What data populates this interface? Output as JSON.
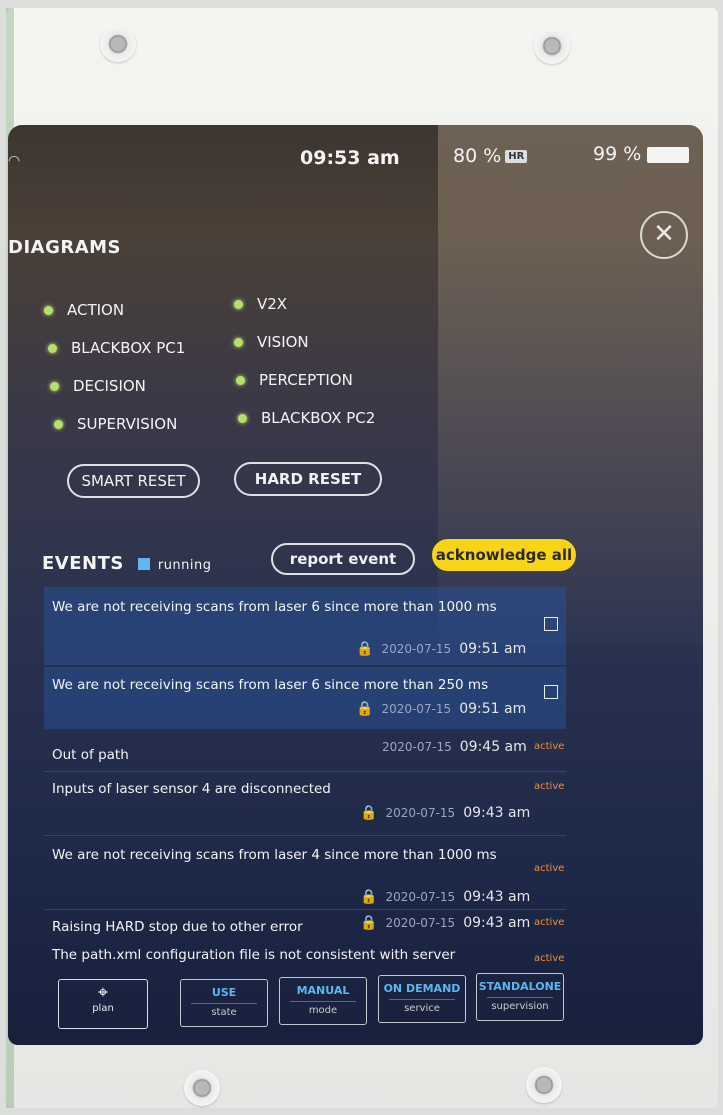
{
  "status_bar": {
    "time": "09:53 am",
    "hr_level": "80 %",
    "hr_badge": "HR",
    "battery_level": "99 %"
  },
  "diagrams": {
    "title": "DIAGRAMS",
    "left_items": [
      "ACTION",
      "BLACKBOX PC1",
      "DECISION",
      "SUPERVISION"
    ],
    "right_items": [
      "V2X",
      "VISION",
      "PERCEPTION",
      "BLACKBOX PC2"
    ],
    "indicator_color": "#b6e06a",
    "smart_reset_label": "SMART RESET",
    "hard_reset_label": "HARD RESET"
  },
  "events": {
    "title": "EVENTS",
    "running_label": "running",
    "report_event_label": "report event",
    "acknowledge_all_label": "acknowledge all",
    "accent_color": "#f7d516",
    "items": [
      {
        "message": "We are not receiving scans from laser 6 since more than 1000 ms",
        "date": "2020-07-15",
        "time": "09:51 am",
        "status": ""
      },
      {
        "message": "We are not receiving scans from laser 6 since more than 250 ms",
        "date": "2020-07-15",
        "time": "09:51 am",
        "status": ""
      },
      {
        "message": "Out of path",
        "date": "2020-07-15",
        "time": "09:45 am",
        "status": "active"
      },
      {
        "message": "Inputs of laser sensor 4 are disconnected",
        "date": "2020-07-15",
        "time": "09:43 am",
        "status": "active"
      },
      {
        "message": "We are not receiving scans from laser 4 since more than 1000 ms",
        "date": "2020-07-15",
        "time": "09:43 am",
        "status": "active"
      },
      {
        "message": "Raising HARD stop due to other error",
        "date": "2020-07-15",
        "time": "09:43 am",
        "status": "active"
      },
      {
        "message": "The path.xml configuration file is not consistent with server",
        "date": "",
        "time": "",
        "status": "active"
      }
    ]
  },
  "bottom_bar": {
    "plan_label": "plan",
    "tabs": [
      {
        "top": "USE",
        "bottom": "state"
      },
      {
        "top": "MANUAL",
        "bottom": "mode"
      },
      {
        "top": "ON DEMAND",
        "bottom": "service"
      },
      {
        "top": "STANDALONE",
        "bottom": "supervision"
      }
    ]
  }
}
